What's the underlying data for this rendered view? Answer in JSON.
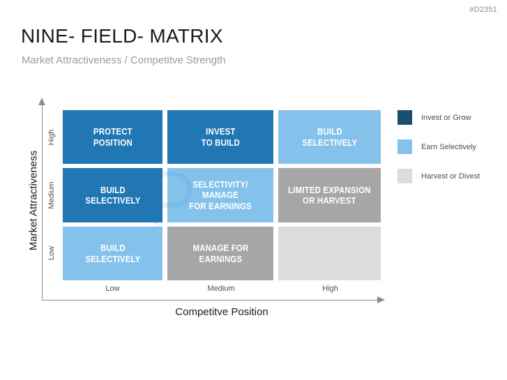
{
  "slide": {
    "id_code": "#D2351",
    "title": "NINE- FIELD- MATRIX",
    "subtitle": "Market Attractiveness / Competitve Strength"
  },
  "colors": {
    "dark_blue": "#17506f",
    "medium_blue": "#2077b4",
    "light_blue": "#85c2eb",
    "medium_gray": "#a6a6a6",
    "light_gray": "#dcdcdc",
    "axis": "#8d8d8d",
    "text": "#1a1a1a",
    "subtitle": "#9b9b9b"
  },
  "axes": {
    "y_title": "Market Attractiveness",
    "x_title": "Competitve Position",
    "y_ticks": [
      "High",
      "Medium",
      "Low"
    ],
    "x_ticks": [
      "Low",
      "Medium",
      "High"
    ]
  },
  "legend": {
    "items": [
      {
        "label": "Invest or Grow",
        "color": "#17506f"
      },
      {
        "label": "Earn Selectively",
        "color": "#85c2eb"
      },
      {
        "label": "Harvest or Divest",
        "color": "#dcdcdc"
      }
    ]
  },
  "chart_data": {
    "type": "heatmap",
    "title": "NINE- FIELD- MATRIX",
    "subtitle": "Market Attractiveness / Competitve Strength",
    "xlabel": "Competitve Position",
    "ylabel": "Market Attractiveness",
    "x_categories": [
      "Low",
      "Medium",
      "High"
    ],
    "y_categories": [
      "High",
      "Medium",
      "Low"
    ],
    "grid": false,
    "legend_position": "right",
    "cells": [
      {
        "row": "High",
        "col": "Low",
        "line1": "PROTECT",
        "line2": "POSITION",
        "color": "#2077b4",
        "category": "Invest or Grow"
      },
      {
        "row": "High",
        "col": "Medium",
        "line1": "INVEST",
        "line2": "TO BUILD",
        "color": "#2077b4",
        "category": "Invest or Grow"
      },
      {
        "row": "High",
        "col": "High",
        "line1": "BUILD",
        "line2": "SELECTIVELY",
        "color": "#85c2eb",
        "category": "Earn Selectively"
      },
      {
        "row": "Medium",
        "col": "Low",
        "line1": "BUILD",
        "line2": "SELECTIVELY",
        "color": "#2077b4",
        "category": "Invest or Grow"
      },
      {
        "row": "Medium",
        "col": "Medium",
        "line1": "SELECTIVITY/ MANAGE",
        "line2": "FOR  EARNINGS",
        "color": "#85c2eb",
        "category": "Earn Selectively"
      },
      {
        "row": "Medium",
        "col": "High",
        "line1": "LIMITED EXPANSION",
        "line2": "OR HARVEST",
        "color": "#a6a6a6",
        "category": "Harvest or Divest"
      },
      {
        "row": "Low",
        "col": "Low",
        "line1": "BUILD",
        "line2": "SELECTIVELY",
        "color": "#85c2eb",
        "category": "Earn Selectively"
      },
      {
        "row": "Low",
        "col": "Medium",
        "line1": "MANAGE FOR",
        "line2": "EARNINGS",
        "color": "#a6a6a6",
        "category": "Harvest or Divest"
      },
      {
        "row": "Low",
        "col": "High",
        "line1": "",
        "line2": "",
        "color": "#dcdcdc",
        "category": "Harvest or Divest"
      }
    ]
  }
}
